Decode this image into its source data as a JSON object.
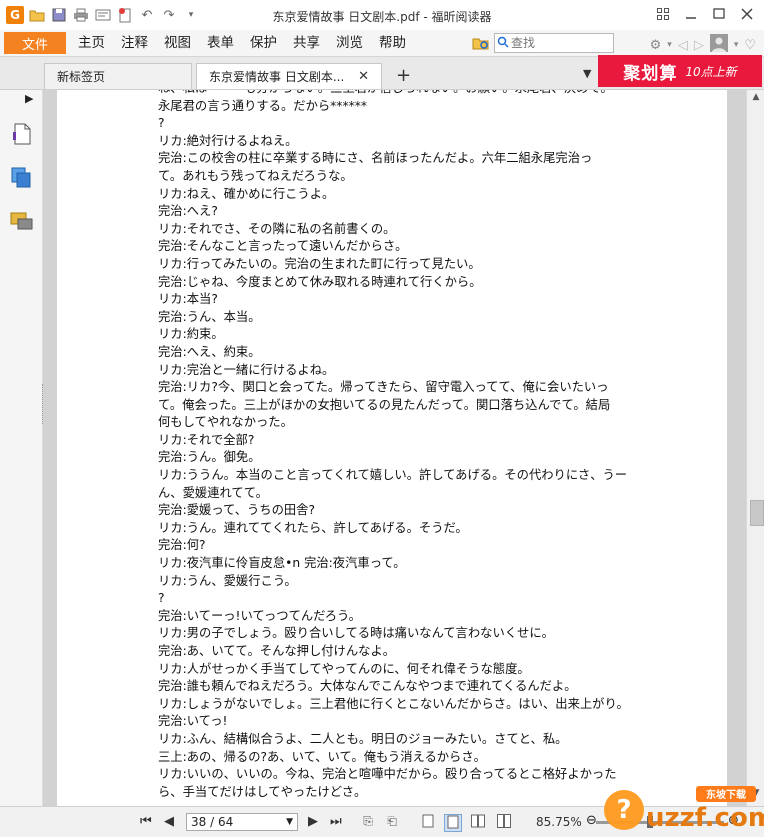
{
  "window": {
    "title": "东京爱情故事 日文剧本.pdf - 福昕阅读器"
  },
  "menubar": {
    "file_label": "文件",
    "items": [
      "主页",
      "注释",
      "视图",
      "表单",
      "保护",
      "共享",
      "浏览",
      "帮助"
    ],
    "search_placeholder": "查找"
  },
  "tabs": {
    "new_tab_label": "新标签页",
    "doc_tab_label": "东京爱情故事 日文剧本...",
    "add_label": "+"
  },
  "banner": {
    "main": "聚划算",
    "sub": "10点上新"
  },
  "document": {
    "lines": [
      "ね、私は******も分からない。三上君が信じられない。お願い。永尾君、決めて。",
      "永尾君の言う通りする。だから******",
      "?",
      "リカ:絶対行けるよねえ。",
      "完治:この校舎の柱に卒業する時にさ、名前ほったんだよ。六年二組永尾完治っ",
      "て。あれもう残ってねえだろうな。",
      "リカ:ねえ、確かめに行こうよ。",
      "完治:へえ?",
      "リカ:それでさ、その隣に私の名前書くの。",
      "完治:そんなこと言ったって遠いんだからさ。",
      "リカ:行ってみたいの。完治の生まれた町に行って見たい。",
      "完治:じゃね、今度まとめて休み取れる時連れて行くから。",
      "リカ:本当?",
      "完治:うん、本当。",
      "リカ:約束。",
      "完治:へえ、約束。",
      "リカ:完治と一緒に行けるよね。",
      "完治:リカ?今、関口と会ってた。帰ってきたら、留守電入ってて、俺に会いたいっ",
      "て。俺会った。三上がほかの女抱いてるの見たんだって。関口落ち込んでて。結局",
      "何もしてやれなかった。",
      "リカ:それで全部?",
      "完治:うん。御免。",
      "リカ:ううん。本当のこと言ってくれて嬉しい。許してあげる。その代わりにさ、うー",
      "ん、愛媛連れてて。",
      "完治:愛媛って、うちの田舎?",
      "リカ:うん。連れててくれたら、許してあげる。そうだ。",
      "完治:何?",
      "リカ:夜汽車に伶盲皮怠•n 完治:夜汽車って。",
      "リカ:うん、愛媛行こう。",
      "?",
      "完治:いてーっ!いてっつてんだろう。",
      "リカ:男の子でしょう。殴り合いしてる時は痛いなんて言わないくせに。",
      "完治:あ、いてて。そんな押し付けんなよ。",
      "リカ:人がせっかく手当てしてやってんのに、何それ偉そうな態度。",
      "完治:誰も頼んでねえだろう。大体なんでこんなやつまで連れてくるんだよ。",
      "リカ:しょうがないでしょ。三上君他に行くとこないんだからさ。はい、出来上がり。",
      "完治:いてっ!",
      "リカ:ふん、結構似合うよ、二人とも。明日のジョーみたい。さてと、私。",
      "三上:あの、帰るの?あ、いて、いて。俺もう消えるからさ。",
      "リカ:いいの、いいの。今ね、完治と喧嘩中だから。殴り合ってるとこ格好よかった",
      "ら、手当てだけはしてやったけどさ。"
    ]
  },
  "statusbar": {
    "page_indicator": "38 / 64",
    "zoom": "85.75%",
    "zoom_level_fraction": 0.42
  },
  "watermark": {
    "text": "uzzf.com",
    "sub": "东坡下载"
  },
  "colors": {
    "accent_orange": "#f58220",
    "banner_red": "#e8193c"
  }
}
